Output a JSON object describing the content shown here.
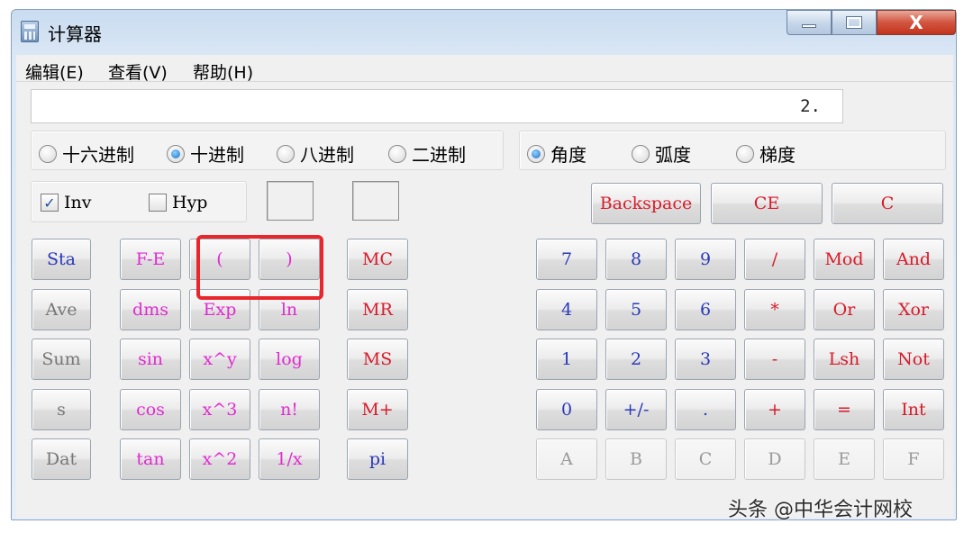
{
  "window": {
    "title": "计算器"
  },
  "title_buttons": {
    "close_glyph": "X"
  },
  "menu": [
    "编辑(E)",
    "查看(V)",
    "帮助(H)"
  ],
  "display": {
    "value": "2."
  },
  "number_base": {
    "options": [
      "十六进制",
      "十进制",
      "八进制",
      "二进制"
    ],
    "selected": "十进制"
  },
  "angle_unit": {
    "options": [
      "角度",
      "弧度",
      "梯度"
    ],
    "selected": "角度"
  },
  "checkboxes": {
    "inv": {
      "label": "Inv",
      "checked": true
    },
    "hyp": {
      "label": "Hyp",
      "checked": false
    }
  },
  "top_buttons": {
    "backspace": "Backspace",
    "ce": "CE",
    "c": "C"
  },
  "stat_buttons": [
    "Sta",
    "Ave",
    "Sum",
    "s",
    "Dat"
  ],
  "sci_buttons": {
    "row1": [
      "F-E",
      "(",
      ")"
    ],
    "row2": [
      "dms",
      "Exp",
      "ln"
    ],
    "row3": [
      "sin",
      "x^y",
      "log"
    ],
    "row4": [
      "cos",
      "x^3",
      "n!"
    ],
    "row5": [
      "tan",
      "x^2",
      "1/x"
    ]
  },
  "memory_buttons": [
    "MC",
    "MR",
    "MS",
    "M+",
    "pi"
  ],
  "keypad": {
    "row1": [
      "7",
      "8",
      "9",
      "/",
      "Mod",
      "And"
    ],
    "row2": [
      "4",
      "5",
      "6",
      "*",
      "Or",
      "Xor"
    ],
    "row3": [
      "1",
      "2",
      "3",
      "-",
      "Lsh",
      "Not"
    ],
    "row4": [
      "0",
      "+/-",
      ".",
      "+",
      "=",
      "Int"
    ],
    "row5": [
      "A",
      "B",
      "C",
      "D",
      "E",
      "F"
    ]
  },
  "watermark": "头条 @中华会计网校",
  "colors": {
    "blue": "#2a39b8",
    "pink": "#e12ad0",
    "red": "#d81b2a",
    "highlight": "#e8262b"
  }
}
